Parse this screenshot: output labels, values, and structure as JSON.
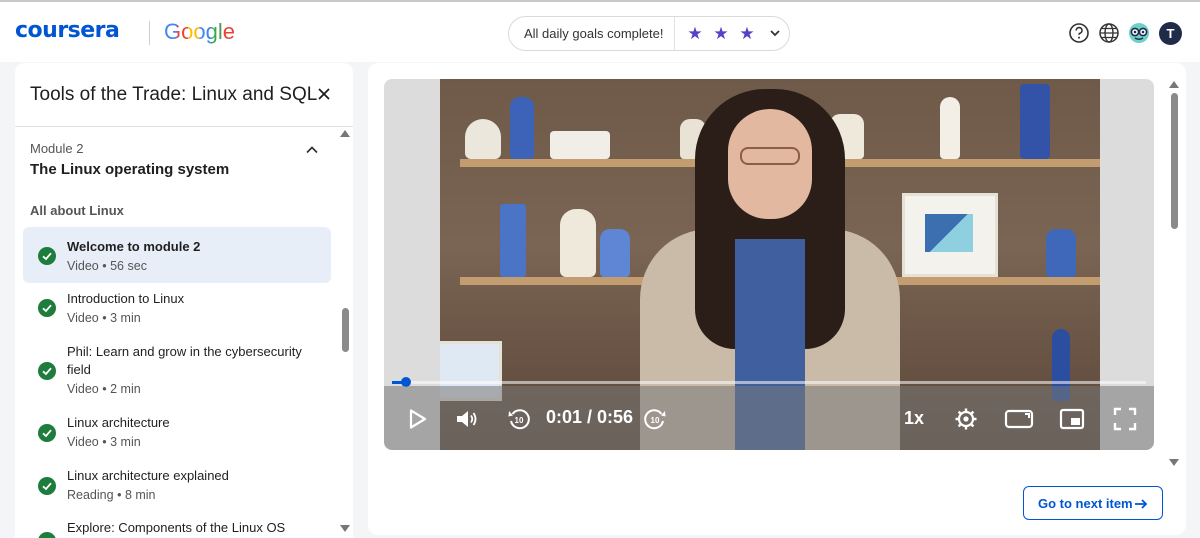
{
  "header": {
    "logo": "coursera",
    "partner": "Google",
    "goals_text": "All daily goals complete!",
    "goals_stars": 3,
    "colors": {
      "brand": "#0056d2",
      "star": "#5b3fc9"
    },
    "icons": [
      "help-icon",
      "globe-icon",
      "coach-icon"
    ],
    "avatar_initial": "T"
  },
  "sidebar": {
    "course_title": "Tools of the Trade: Linux and SQL",
    "module_label": "Module 2",
    "module_name": "The Linux operating system",
    "section_label": "All about Linux",
    "items": [
      {
        "title": "Welcome to module 2",
        "type": "Video",
        "duration": "56 sec",
        "active": true
      },
      {
        "title": "Introduction to Linux",
        "type": "Video",
        "duration": "3 min"
      },
      {
        "title": "Phil: Learn and grow in the cybersecurity field",
        "type": "Video",
        "duration": "2 min"
      },
      {
        "title": "Linux architecture",
        "type": "Video",
        "duration": "3 min"
      },
      {
        "title": "Linux architecture explained",
        "type": "Reading",
        "duration": "8 min"
      },
      {
        "title": "Explore: Components of the Linux OS",
        "type": "",
        "duration": ""
      }
    ],
    "meta_separator": "•"
  },
  "player": {
    "time_display": "0:01 / 0:56",
    "progress_fraction": 0.018,
    "speed": "1x",
    "rewind_seconds": "10",
    "forward_seconds": "10"
  },
  "next_item_label": "Go to next item"
}
